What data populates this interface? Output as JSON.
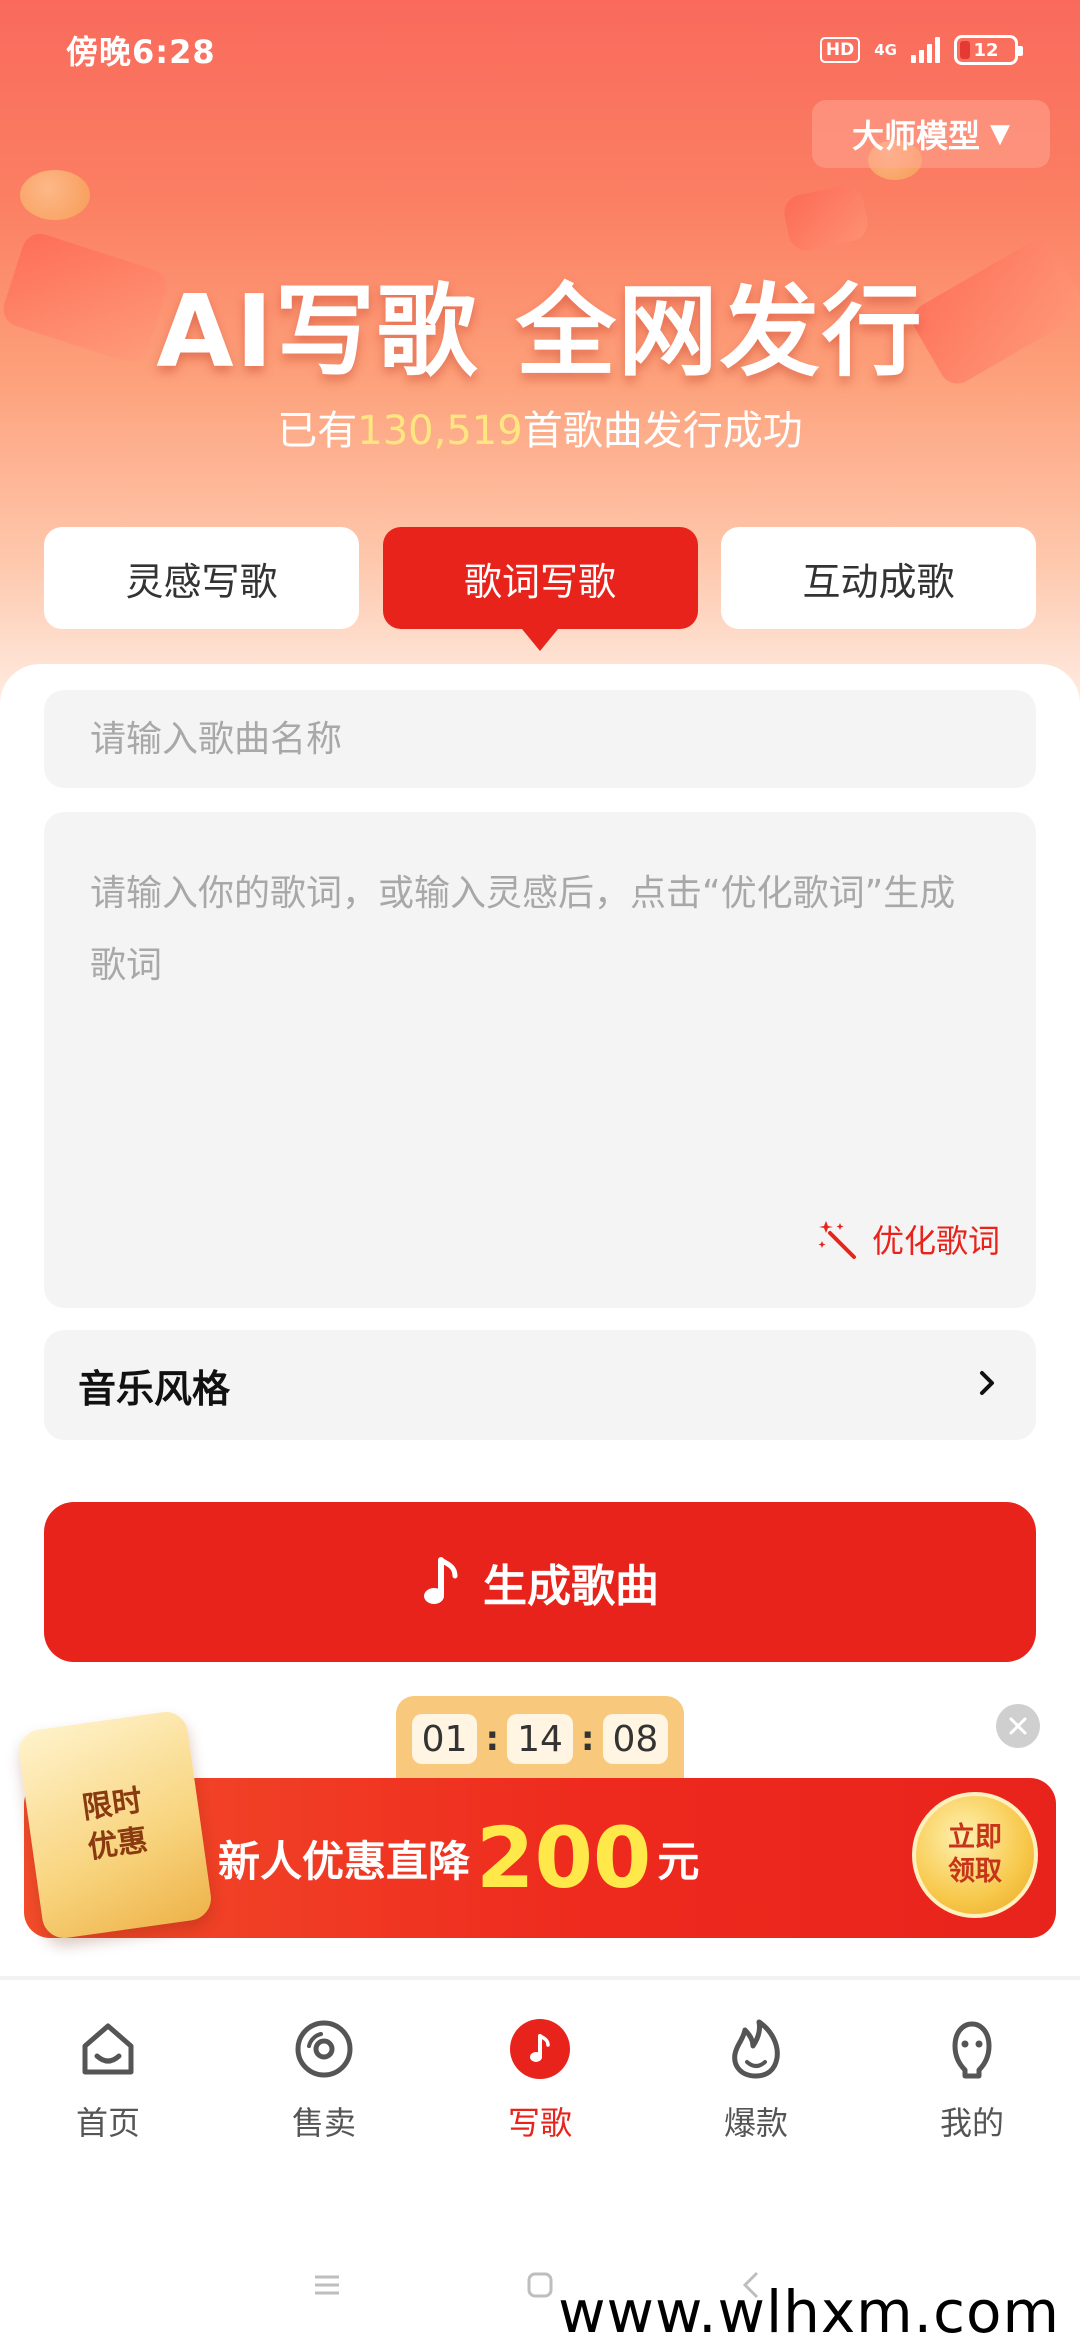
{
  "status_bar": {
    "time": "傍晚6:28",
    "hd": "HD",
    "network": "4G",
    "battery": "12"
  },
  "header": {
    "model_selector": "大师模型",
    "title": "AI写歌 全网发行",
    "subtitle_prefix": "已有",
    "subtitle_count": "130,519",
    "subtitle_suffix": "首歌曲发行成功"
  },
  "tabs": [
    {
      "label": "灵感写歌",
      "active": false
    },
    {
      "label": "歌词写歌",
      "active": true
    },
    {
      "label": "互动成歌",
      "active": false
    }
  ],
  "form": {
    "song_name_placeholder": "请输入歌曲名称",
    "lyrics_placeholder": "请输入你的歌词，或输入灵感后，点击“优化歌词”生成歌词",
    "optimize_label": "优化歌词",
    "music_style_label": "音乐风格",
    "generate_label": "生成歌曲"
  },
  "promo": {
    "timer": {
      "hours": "01",
      "minutes": "14",
      "seconds": "08",
      "separator": ":"
    },
    "badge": "限时优惠",
    "text_prefix": "新人优惠直降",
    "amount": "200",
    "unit": "元",
    "claim": "立即领取"
  },
  "bottom_nav": [
    {
      "label": "首页",
      "icon": "home-icon",
      "active": false
    },
    {
      "label": "售卖",
      "icon": "disc-icon",
      "active": false
    },
    {
      "label": "写歌",
      "icon": "music-note-icon",
      "active": true
    },
    {
      "label": "爆款",
      "icon": "flame-icon",
      "active": false
    },
    {
      "label": "我的",
      "icon": "profile-icon",
      "active": false
    }
  ],
  "watermark": "www.wlhxm.com",
  "colors": {
    "accent": "#e8231c",
    "highlight": "#ffe680",
    "promo_amount": "#ffe94a"
  }
}
